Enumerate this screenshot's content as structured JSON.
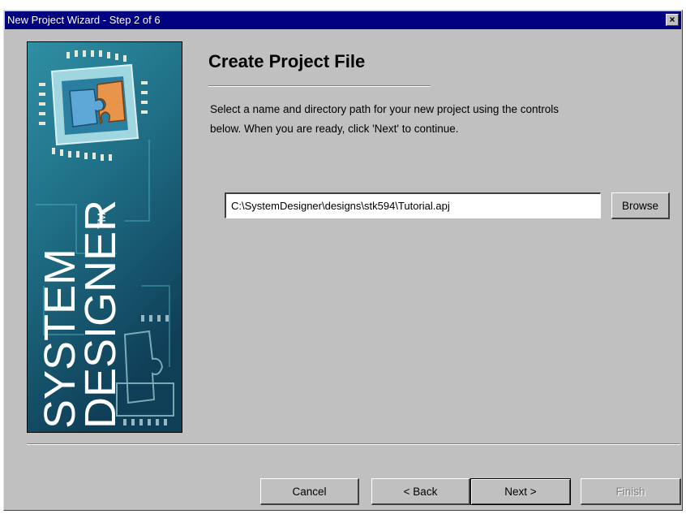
{
  "window": {
    "title": "New Project Wizard - Step 2 of 6",
    "close_glyph": "×"
  },
  "side_image": {
    "brand_line1": "SYSTEM",
    "brand_line2": "DESIGNER",
    "trademark": "TM"
  },
  "main": {
    "heading": "Create Project File",
    "description_line1": "Select a name and directory path for your new project using the controls",
    "description_line2": "below. When you are ready, click 'Next' to continue.",
    "path_value": "C:\\SystemDesigner\\designs\\stk594\\Tutorial.apj",
    "browse_label": "Browse"
  },
  "footer": {
    "cancel_label": "Cancel",
    "back_label": "< Back",
    "next_label": "Next >",
    "finish_label": "Finish"
  }
}
